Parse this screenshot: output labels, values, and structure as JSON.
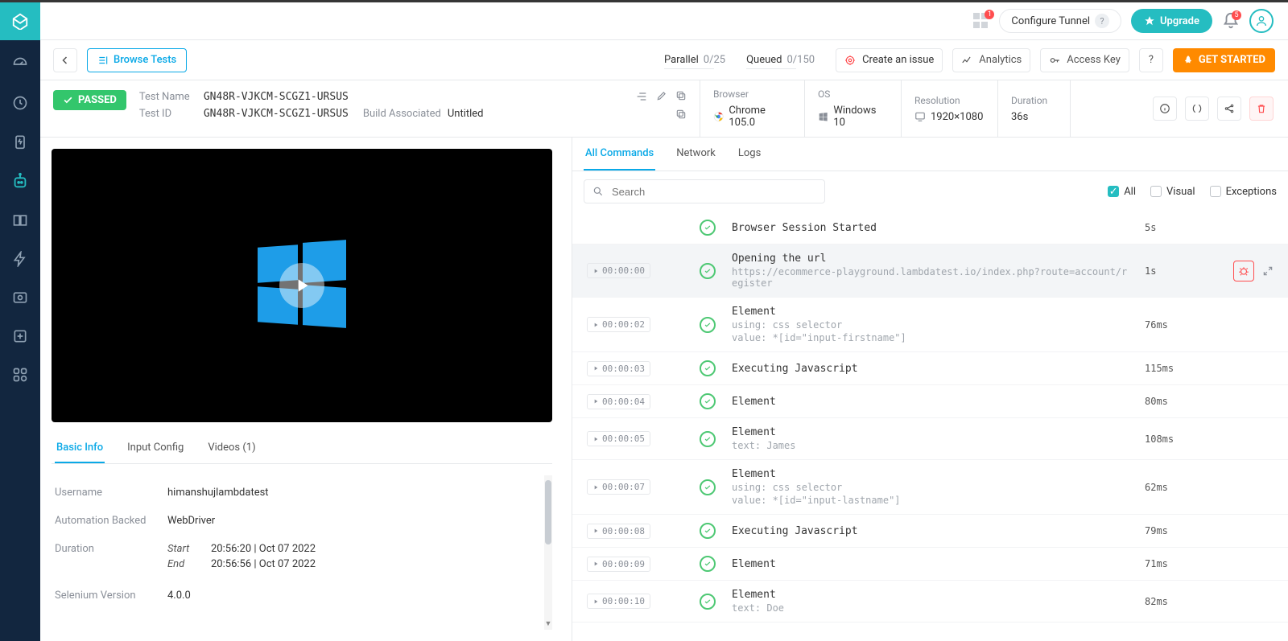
{
  "header": {
    "grid_badge": "1",
    "configure_tunnel": "Configure Tunnel",
    "upgrade": "Upgrade",
    "bell_badge": "5"
  },
  "toolbar": {
    "browse_tests": "Browse Tests",
    "parallel_label": "Parallel",
    "parallel_value": "0/25",
    "queued_label": "Queued",
    "queued_value": "0/150",
    "create_issue": "Create an issue",
    "analytics": "Analytics",
    "access_key": "Access Key",
    "help": "?",
    "get_started": "GET STARTED"
  },
  "status": {
    "passed": "PASSED"
  },
  "meta_left": {
    "test_name_lbl": "Test Name",
    "test_name": "GN48R-VJKCM-SCGZ1-URSUS",
    "test_id_lbl": "Test ID",
    "test_id": "GN48R-VJKCM-SCGZ1-URSUS",
    "build_assoc_lbl": "Build Associated",
    "build_assoc": "Untitled"
  },
  "meta_right": {
    "browser_lbl": "Browser",
    "browser": "Chrome 105.0",
    "os_lbl": "OS",
    "os": "Windows 10",
    "res_lbl": "Resolution",
    "res": "1920×1080",
    "dur_lbl": "Duration",
    "dur": "36s"
  },
  "left_tabs": {
    "basic": "Basic Info",
    "input": "Input Config",
    "videos": "Videos (1)"
  },
  "basic_info": {
    "username_lbl": "Username",
    "username": "himanshujlambdatest",
    "backed_lbl": "Automation Backed",
    "backed": "WebDriver",
    "duration_lbl": "Duration",
    "start_lbl": "Start",
    "start": "20:56:20 | Oct 07 2022",
    "end_lbl": "End",
    "end": "20:56:56 | Oct 07 2022",
    "selenium_lbl": "Selenium Version",
    "selenium": "4.0.0"
  },
  "right_tabs": {
    "all": "All Commands",
    "network": "Network",
    "logs": "Logs"
  },
  "filter": {
    "search_placeholder": "Search",
    "all": "All",
    "visual": "Visual",
    "exceptions": "Exceptions"
  },
  "commands": [
    {
      "time": "",
      "title": "Browser Session Started",
      "sub": "",
      "dur": "5s"
    },
    {
      "time": "00:00:00",
      "title": "Opening the url",
      "sub": "https://ecommerce-playground.lambdatest.io/index.php?route=account/register",
      "dur": "1s",
      "sel": true
    },
    {
      "time": "00:00:02",
      "title": "Element",
      "sub": "using: css selector\nvalue: *[id=\"input-firstname\"]",
      "dur": "76ms"
    },
    {
      "time": "00:00:03",
      "title": "Executing Javascript",
      "sub": "",
      "dur": "115ms"
    },
    {
      "time": "00:00:04",
      "title": "Element",
      "sub": "",
      "dur": "80ms"
    },
    {
      "time": "00:00:05",
      "title": "Element",
      "sub": "text: James",
      "dur": "108ms"
    },
    {
      "time": "00:00:07",
      "title": "Element",
      "sub": "using: css selector\nvalue: *[id=\"input-lastname\"]",
      "dur": "62ms"
    },
    {
      "time": "00:00:08",
      "title": "Executing Javascript",
      "sub": "",
      "dur": "79ms"
    },
    {
      "time": "00:00:09",
      "title": "Element",
      "sub": "",
      "dur": "71ms"
    },
    {
      "time": "00:00:10",
      "title": "Element",
      "sub": "text: Doe",
      "dur": "82ms"
    }
  ]
}
